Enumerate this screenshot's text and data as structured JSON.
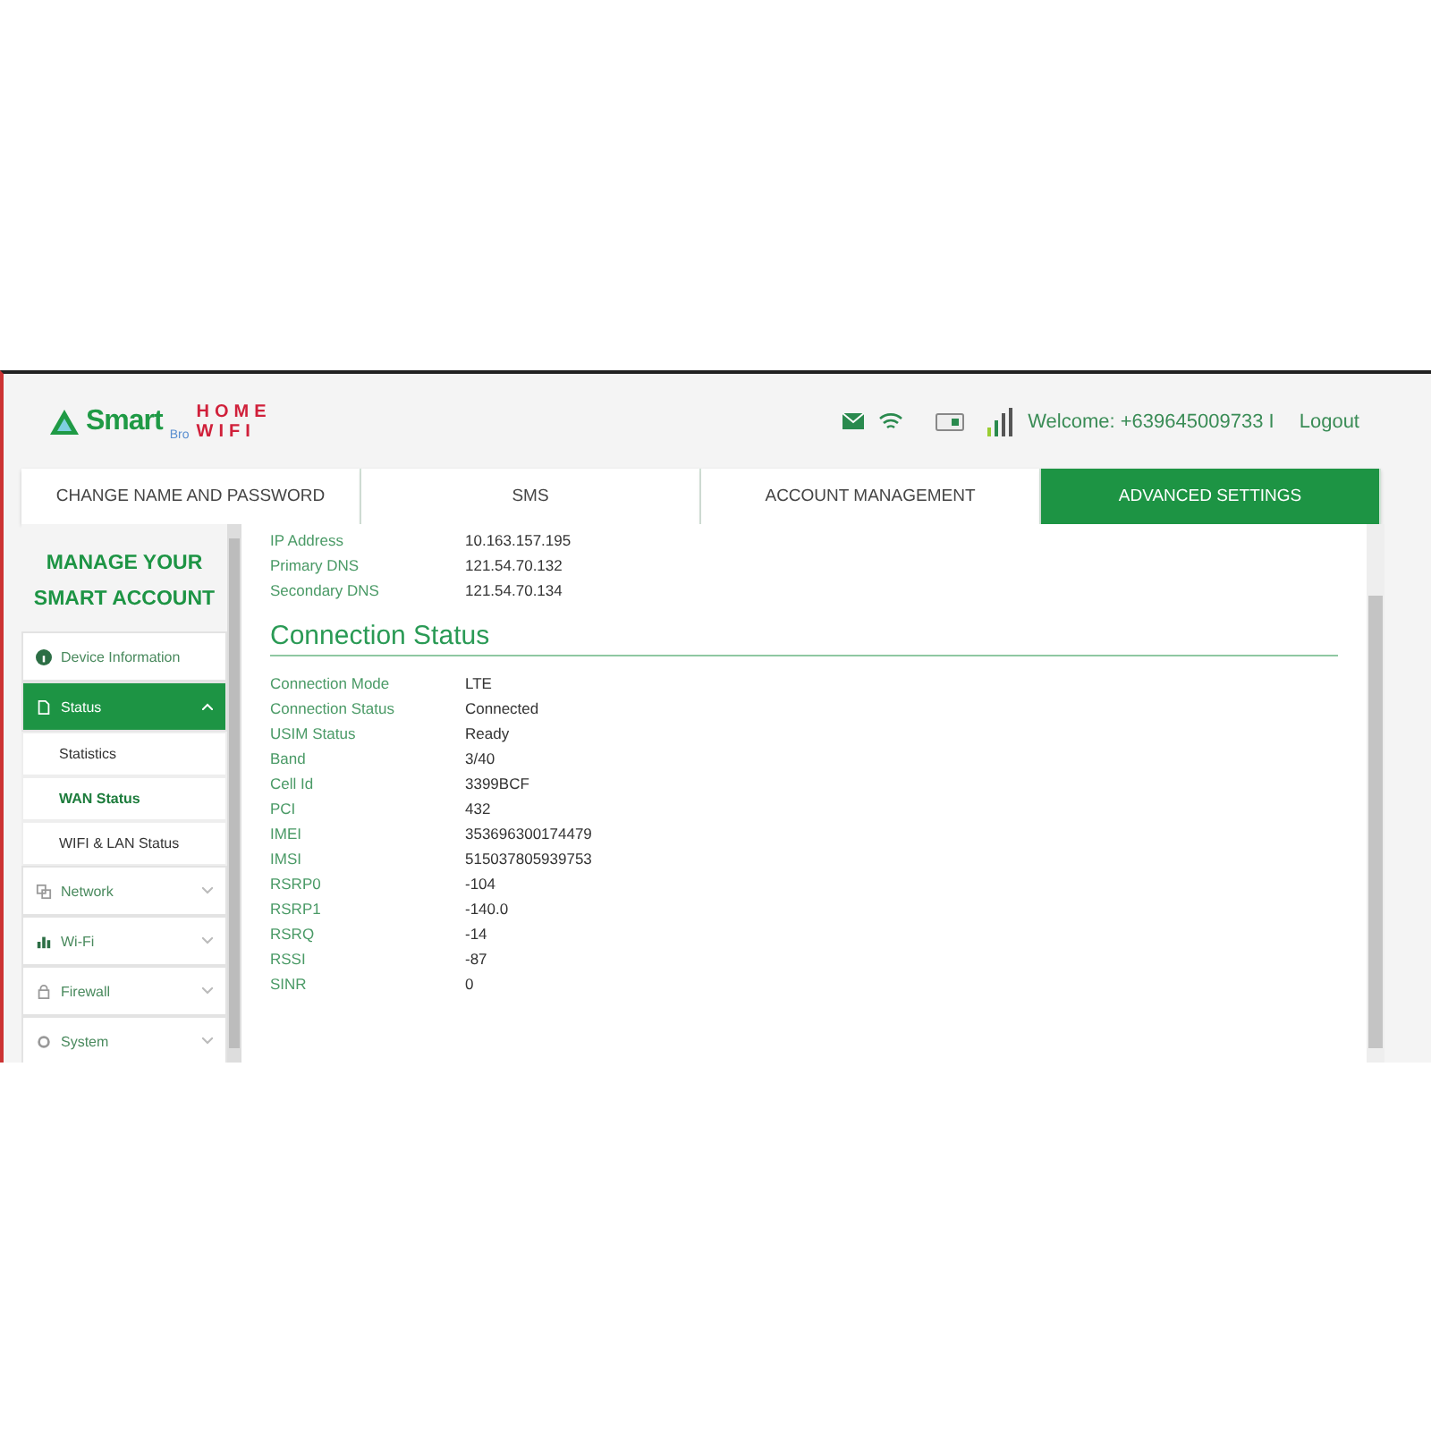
{
  "logo": {
    "brand": "Smart",
    "sub": "Bro",
    "line1": "HOME",
    "line2": "WIFI"
  },
  "header": {
    "welcome": "Welcome: +639645009733 I",
    "logout": "Logout"
  },
  "tabs": [
    {
      "label": "CHANGE NAME AND PASSWORD",
      "selected": false
    },
    {
      "label": "SMS",
      "selected": false
    },
    {
      "label": "ACCOUNT MANAGEMENT",
      "selected": false
    },
    {
      "label": "ADVANCED SETTINGS",
      "selected": true
    }
  ],
  "sidebar": {
    "title": "MANAGE YOUR SMART ACCOUNT",
    "items": [
      {
        "label": "Device Information",
        "kind": "link",
        "selected": false
      },
      {
        "label": "Status",
        "kind": "group",
        "selected": true,
        "expanded": true,
        "children": [
          {
            "label": "Statistics",
            "selected": false
          },
          {
            "label": "WAN Status",
            "selected": true
          },
          {
            "label": "WIFI & LAN Status",
            "selected": false
          }
        ]
      },
      {
        "label": "Network",
        "kind": "group",
        "selected": false,
        "expanded": false
      },
      {
        "label": "Wi-Fi",
        "kind": "group",
        "selected": false,
        "expanded": false
      },
      {
        "label": "Firewall",
        "kind": "group",
        "selected": false,
        "expanded": false
      },
      {
        "label": "System",
        "kind": "group",
        "selected": false,
        "expanded": false
      }
    ]
  },
  "top_rows": [
    {
      "label": "IP Address",
      "value": "10.163.157.195"
    },
    {
      "label": "Primary DNS",
      "value": "121.54.70.132"
    },
    {
      "label": "Secondary DNS",
      "value": "121.54.70.134"
    }
  ],
  "connection_status": {
    "title": "Connection Status",
    "rows": [
      {
        "label": "Connection Mode",
        "value": "LTE"
      },
      {
        "label": "Connection Status",
        "value": "Connected"
      },
      {
        "label": "USIM Status",
        "value": "Ready"
      },
      {
        "label": "Band",
        "value": "3/40"
      },
      {
        "label": "Cell Id",
        "value": "3399BCF"
      },
      {
        "label": "PCI",
        "value": "432"
      },
      {
        "label": "IMEI",
        "value": "353696300174479"
      },
      {
        "label": "IMSI",
        "value": "515037805939753"
      },
      {
        "label": "RSRP0",
        "value": "-104"
      },
      {
        "label": "RSRP1",
        "value": "-140.0"
      },
      {
        "label": "RSRQ",
        "value": "-14"
      },
      {
        "label": "RSSI",
        "value": "-87"
      },
      {
        "label": "SINR",
        "value": "0"
      }
    ]
  }
}
